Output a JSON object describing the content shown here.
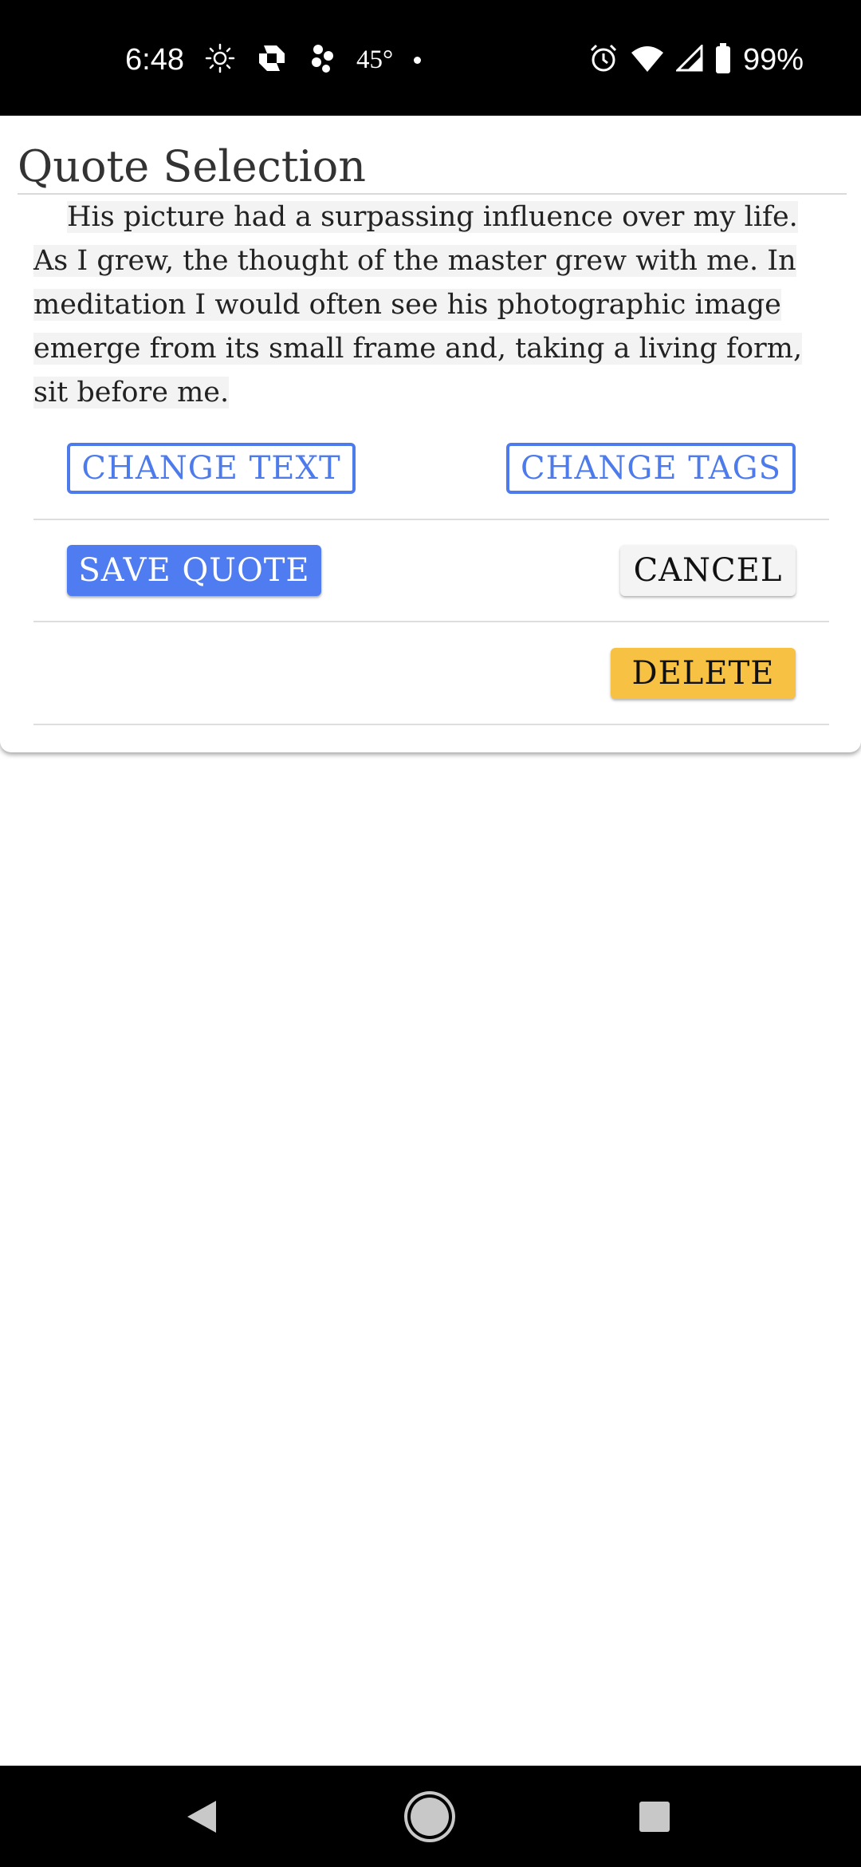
{
  "status_bar": {
    "time": "6:48",
    "temperature": "45°",
    "battery": "99%"
  },
  "dialog": {
    "title": "Quote Selection",
    "quote_lines": [
      "His picture had a surpassing influence over my life. As",
      "I grew, the thought of the master grew with me. In",
      "meditation I would often see his photographic image",
      "emerge from its small frame and, taking a living form, sit",
      "before me."
    ],
    "change_text_label": "CHANGE TEXT",
    "change_tags_label": "CHANGE TAGS",
    "save_label": "SAVE QUOTE",
    "cancel_label": "CANCEL",
    "delete_label": "DELETE"
  },
  "colors": {
    "primary": "#507cf2",
    "warning": "#f7c244"
  },
  "icons": {
    "status": [
      "sun-icon",
      "bank-icon",
      "pinwheel-icon",
      "alarm-icon",
      "wifi-icon",
      "signal-icon",
      "battery-icon"
    ],
    "nav": [
      "back-icon",
      "home-icon",
      "recents-icon"
    ]
  }
}
